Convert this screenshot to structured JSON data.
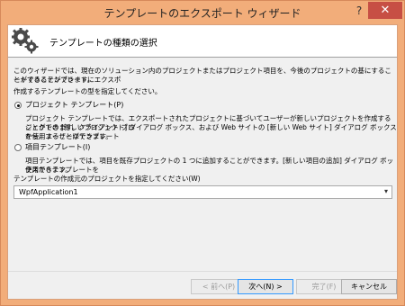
{
  "window": {
    "title": "テンプレートのエクスポート ウィザード",
    "help_glyph": "?",
    "close_glyph": "✕"
  },
  "banner": {
    "heading": "テンプレートの種類の選択",
    "icon": "gear-icon"
  },
  "intro": {
    "line1": "このウィザードでは、現在のソリューション内のプロジェクトまたはプロジェクト項目を、今後のプロジェクトの基にすることができるテンプレートにエクスポ",
    "line2": "ートすることができます。",
    "prompt": "作成するテンプレートの型を指定してください。"
  },
  "options": [
    {
      "label": "プロジェクト テンプレート(P)",
      "selected": true,
      "description": [
        "プロジェクト テンプレートでは、エクスポートされたプロジェクトに基づいてユーザーが新しいプロジェクトを作成することができます。クライアント プロ",
        "ジェクトの [新しいプロジェクト] ダイアログ ボックス、および Web サイトの [新しい Web サイト] ダイアログ ボックスから、ユーザーはテンプレート",
        "を使用することができます。"
      ]
    },
    {
      "label": "項目テンプレート(I)",
      "selected": false,
      "description": [
        "項目テンプレートでは、項目を既存プロジェクトの 1 つに追加することができます。[新しい項目の追加] ダイアログ ボックスからテンプレートを",
        "使用できます。"
      ]
    }
  ],
  "project_select": {
    "label": "テンプレートの作成元のプロジェクトを指定してください(W)",
    "value": "WpfApplication1"
  },
  "buttons": {
    "back": "< 前へ(P)",
    "next": "次へ(N) >",
    "finish": "完了(F)",
    "cancel": "キャンセル"
  },
  "colors": {
    "frame": "#f2ad7a",
    "close": "#c74f44",
    "focus": "#3399ff"
  }
}
